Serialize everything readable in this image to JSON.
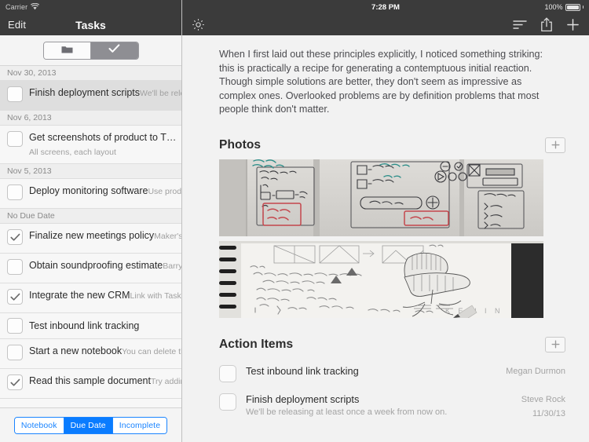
{
  "status_bar": {
    "carrier": "Carrier",
    "wifi_icon": "wifi-icon",
    "time": "7:28 PM",
    "battery_percent": "100%"
  },
  "sidebar": {
    "nav": {
      "edit_label": "Edit",
      "title": "Tasks"
    },
    "top_segmented": {
      "options": [
        "folder-icon",
        "check-icon"
      ],
      "selected_index": 1
    },
    "groups": [
      {
        "date": "Nov 30, 2013",
        "tasks": [
          {
            "title": "Finish deployment scripts",
            "subtitle": "We'll be releasing at least once a we…",
            "checked": false,
            "selected": true
          }
        ]
      },
      {
        "date": "Nov 6, 2013",
        "tasks": [
          {
            "title": "Get screenshots of product to T…",
            "subtitle": "All screens, each layout",
            "checked": false,
            "selected": false
          }
        ]
      },
      {
        "date": "Nov 5, 2013",
        "tasks": [
          {
            "title": "Deploy monitoring software",
            "subtitle": "Use production server, Lisa has the c…",
            "checked": false,
            "selected": false
          }
        ]
      },
      {
        "date": "No Due Date",
        "tasks": [
          {
            "title": "Finalize new meetings policy",
            "subtitle": "Maker's schedule, manager's sched…",
            "checked": true,
            "selected": false
          },
          {
            "title": "Obtain soundproofing estimate",
            "subtitle": "Barry at NoiseSolutions can be reach…",
            "checked": false,
            "selected": false
          },
          {
            "title": "Integrate the new CRM",
            "subtitle": "Link with Taskboard for easier task tr…",
            "checked": true,
            "selected": false
          },
          {
            "title": "Test inbound link tracking",
            "subtitle": "",
            "checked": false,
            "selected": false
          },
          {
            "title": "Start a new notebook",
            "subtitle": "You can delete this document and its…",
            "checked": false,
            "selected": false
          },
          {
            "title": "Read this sample document",
            "subtitle": "Try adding some attendees from you…",
            "checked": true,
            "selected": false
          }
        ]
      }
    ],
    "bottom_segmented": {
      "options": [
        "Notebook",
        "Due Date",
        "Incomplete"
      ],
      "selected_index": 1,
      "accent_color": "#0a7cff"
    }
  },
  "detail": {
    "nav": {
      "gear_icon": "gear-icon",
      "outline_icon": "outline-icon",
      "share_icon": "share-icon",
      "add_icon": "plus-icon"
    },
    "paragraph": "When I first laid out these principles explicitly, I noticed something striking: this is practically a recipe for generating a contemptuous initial reaction. Though simple solutions are better, they don't seem as impressive as complex ones. Overlooked problems are by definition problems that most people think don't matter.",
    "photos_section": {
      "title": "Photos",
      "add_label": "+",
      "photos": [
        {
          "caption": "whiteboard-sketch-campaign-budget"
        },
        {
          "caption": "spiral-notebook-chair-sketch"
        }
      ]
    },
    "action_items_section": {
      "title": "Action Items",
      "add_label": "+",
      "items": [
        {
          "title": "Test inbound link tracking",
          "subtitle": "",
          "assignee": "Megan Durmon",
          "date": "",
          "checked": false
        },
        {
          "title": "Finish deployment scripts",
          "subtitle": "We'll be releasing at least once a week from now on.",
          "assignee": "Steve Rock",
          "date": "11/30/13",
          "checked": false
        }
      ]
    }
  }
}
